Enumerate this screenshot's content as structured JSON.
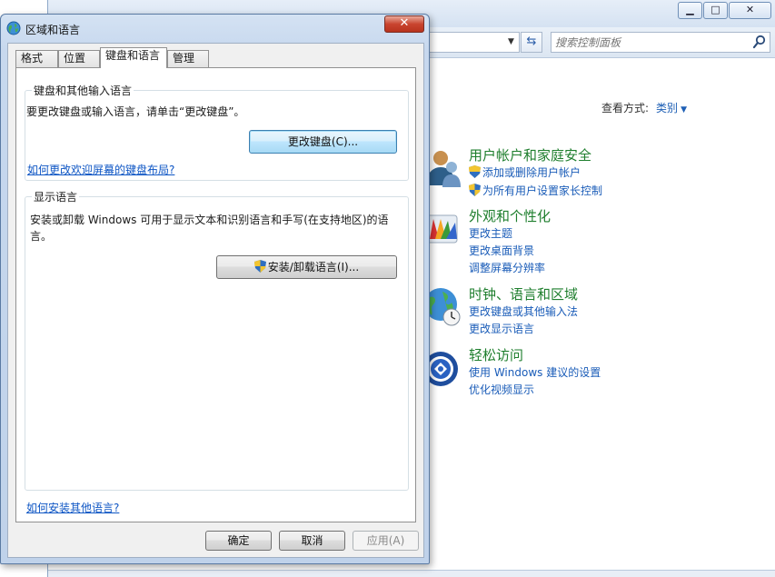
{
  "control_panel": {
    "caption": {
      "minimize_glyph": "▁",
      "maximize_glyph": "□",
      "close_glyph": "✕"
    },
    "search_placeholder": "搜索控制面板",
    "view_by": {
      "label": "查看方式:",
      "value": "类别"
    },
    "categories": [
      {
        "title": "用户帐户和家庭安全",
        "icon": "user-accounts-icon",
        "links": [
          "添加或删除用户帐户",
          "为所有用户设置家长控制"
        ],
        "shielded": [
          true,
          true
        ]
      },
      {
        "title": "外观和个性化",
        "icon": "appearance-icon",
        "links": [
          "更改主题",
          "更改桌面背景",
          "调整屏幕分辨率"
        ]
      },
      {
        "title": "时钟、语言和区域",
        "icon": "globe-clock-icon",
        "links": [
          "更改键盘或其他输入法",
          "更改显示语言"
        ]
      },
      {
        "title": "轻松访问",
        "icon": "ease-of-access-icon",
        "links": [
          "使用 Windows 建议的设置",
          "优化视频显示"
        ]
      }
    ]
  },
  "dialog": {
    "title": "区域和语言",
    "close_glyph": "✕",
    "tabs": [
      "格式",
      "位置",
      "键盘和语言",
      "管理"
    ],
    "active_tab": 2,
    "keyboard_group": {
      "label": "键盘和其他输入语言",
      "description": "要更改键盘或输入语言，请单击“更改键盘”。",
      "button": "更改键盘(C)...",
      "link": "如何更改欢迎屏幕的键盘布局?"
    },
    "display_group": {
      "label": "显示语言",
      "description": "安装或卸载 Windows 可用于显示文本和识别语言和手写(在支持地区)的语言。",
      "button": "安装/卸载语言(I)..."
    },
    "bottom_link": "如何安装其他语言?",
    "buttons": {
      "ok": "确定",
      "cancel": "取消",
      "apply": "应用(A)"
    }
  }
}
